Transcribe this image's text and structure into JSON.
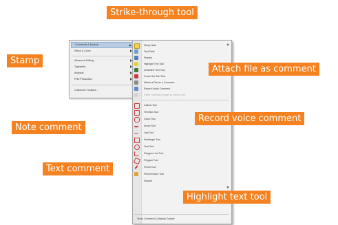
{
  "callouts": {
    "strike_through": "Strike-through tool",
    "stamp": "Stamp",
    "attach_file": "Attach file as comment",
    "note_comment": "Note comment",
    "record_voice": "Record voice comment",
    "text_comment": "Text comment",
    "highlight_text": "Highlight text tool"
  },
  "main_menu": {
    "items": [
      {
        "label": "Comments & Markup"
      },
      {
        "label": "Select & Zoom"
      },
      {
        "label": "Advanced Editing"
      },
      {
        "label": "Typewriter"
      },
      {
        "label": "Analysis"
      },
      {
        "label": "Print Production"
      },
      {
        "label": "Customize Toolbars..."
      }
    ]
  },
  "sub_menu": {
    "items": [
      {
        "label": "Sticky Note"
      },
      {
        "label": "Text Edits"
      },
      {
        "label": "Stamps"
      },
      {
        "label": "Highlight Text Tool"
      },
      {
        "label": "Underline Text Tool"
      },
      {
        "label": "Cross Out Text Tool"
      },
      {
        "label": "Attach a File as a Comment"
      },
      {
        "label": "Record Audio Comment"
      },
      {
        "label": "Paste Clipboard Image as Stamp Tool"
      },
      {
        "label": "Callout Tool"
      },
      {
        "label": "Text Box Tool"
      },
      {
        "label": "Cloud Tool"
      },
      {
        "label": "Arrow Tool"
      },
      {
        "label": "Line Tool"
      },
      {
        "label": "Rectangle Tool"
      },
      {
        "label": "Oval Tool"
      },
      {
        "label": "Polygon Line Tool"
      },
      {
        "label": "Polygon Tool"
      },
      {
        "label": "Pencil Tool"
      },
      {
        "label": "Pencil Eraser Tool"
      },
      {
        "label": "Expand"
      },
      {
        "label": "Show Comment & Markup Toolbar"
      }
    ]
  },
  "colors": {
    "callout": "#f58220",
    "highlight": "#b8cde4"
  },
  "icons": [
    "sticky-note-icon",
    "text-edits-icon",
    "stamp-icon",
    "highlight-icon",
    "underline-icon",
    "cross-out-icon",
    "paperclip-icon",
    "speaker-icon",
    "paste-image-icon",
    "callout-icon",
    "textbox-icon",
    "cloud-icon",
    "arrow-icon",
    "line-icon",
    "rectangle-icon",
    "oval-icon",
    "polygon-line-icon",
    "polygon-icon",
    "pencil-icon",
    "eraser-icon"
  ]
}
